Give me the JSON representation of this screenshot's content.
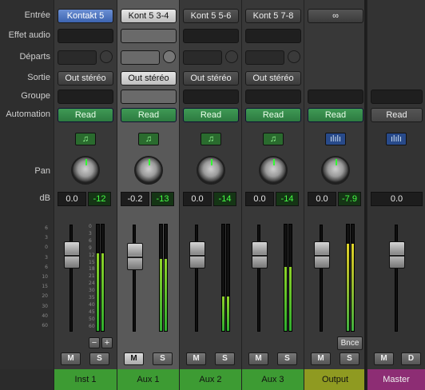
{
  "row_labels": {
    "input": "Entrée",
    "audio_fx": "Effet audio",
    "sends": "Départs",
    "output": "Sortie",
    "group": "Groupe",
    "automation": "Automation",
    "pan": "Pan",
    "db": "dB"
  },
  "scale_ticks": [
    "6",
    "3",
    "0",
    "3",
    "6",
    "10",
    "15",
    "20",
    "30",
    "40",
    "60"
  ],
  "meter_ticks": [
    "0",
    "3",
    "6",
    "9",
    "12",
    "15",
    "18",
    "21",
    "24",
    "30",
    "35",
    "40",
    "45",
    "50",
    "60"
  ],
  "strips": [
    {
      "input": "Kontakt 5",
      "output": "Out stéréo",
      "automation": "Read",
      "icon": "midi-note-icon",
      "icon_glyph": "♫",
      "volume": "0.0",
      "peak": "-12",
      "mute": "M",
      "solo": "S",
      "name": "Inst 1",
      "meter_level": 0.73,
      "extra_minus": "−",
      "extra_plus": "+"
    },
    {
      "input": "Kont 5 3-4",
      "output": "Out stéréo",
      "automation": "Read",
      "icon": "midi-note-icon",
      "icon_glyph": "♫",
      "volume": "-0.2",
      "peak": "-13",
      "mute": "M",
      "solo": "S",
      "name": "Aux 1",
      "meter_level": 0.68
    },
    {
      "input": "Kont 5 5-6",
      "output": "Out stéréo",
      "automation": "Read",
      "icon": "midi-note-icon",
      "icon_glyph": "♫",
      "volume": "0.0",
      "peak": "-14",
      "mute": "M",
      "solo": "S",
      "name": "Aux 2",
      "meter_level": 0.32
    },
    {
      "input": "Kont 5 7-8",
      "output": "Out stéréo",
      "automation": "Read",
      "icon": "midi-note-icon",
      "icon_glyph": "♫",
      "volume": "0.0",
      "peak": "-14",
      "mute": "M",
      "solo": "S",
      "name": "Aux 3",
      "meter_level": 0.6
    },
    {
      "input": "∞",
      "automation": "Read",
      "icon": "waveform-icon",
      "icon_glyph": "ılılı",
      "volume": "0.0",
      "peak": "-7.9",
      "mute": "M",
      "solo": "S",
      "name": "Output",
      "meter_level": 0.82,
      "bounce": "Bnce"
    },
    {
      "automation": "Read",
      "icon": "waveform-icon",
      "icon_glyph": "ılılı",
      "volume": "0.0",
      "mute": "M",
      "solo": "D",
      "name": "Master"
    }
  ],
  "colors": {
    "track_green": "#3d9b33",
    "output_olive": "#8f9a21",
    "master_purple": "#8d2d74",
    "read_green": "#3f9a55",
    "peak_green": "#44ff44"
  }
}
